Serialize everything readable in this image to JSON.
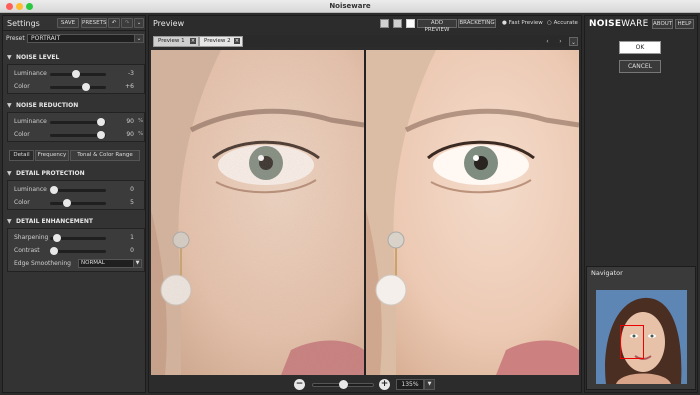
{
  "window": {
    "title": "Noiseware"
  },
  "settings": {
    "title": "Settings",
    "save_label": "SAVE",
    "presets_label": "PRESETS",
    "preset_label": "Preset",
    "preset_value": "PORTRAIT"
  },
  "noise_level": {
    "title": "NOISE LEVEL",
    "rows": [
      {
        "label": "Luminance",
        "value": "-3",
        "level": 0.42
      },
      {
        "label": "Color",
        "value": "+6",
        "level": 0.62
      }
    ]
  },
  "noise_reduction": {
    "title": "NOISE REDUCTION",
    "rows": [
      {
        "label": "Luminance",
        "value": "90",
        "unit": "%",
        "level": 0.9
      },
      {
        "label": "Color",
        "value": "90",
        "unit": "%",
        "level": 0.9
      }
    ]
  },
  "detail_tabs": [
    "Detail",
    "Frequency",
    "Tonal & Color Range"
  ],
  "detail_protection": {
    "title": "DETAIL PROTECTION",
    "rows": [
      {
        "label": "Luminance",
        "value": "0",
        "level": 0.0
      },
      {
        "label": "Color",
        "value": "5",
        "level": 0.25
      }
    ]
  },
  "detail_enhancement": {
    "title": "DETAIL ENHANCEMENT",
    "rows": [
      {
        "label": "Sharpening",
        "value": "1",
        "level": 0.05
      },
      {
        "label": "Contrast",
        "value": "0",
        "level": 0.0
      }
    ],
    "edge_label": "Edge Smoothening",
    "edge_value": "NORMAL"
  },
  "preview": {
    "title": "Preview",
    "add_preview": "ADD PREVIEW",
    "bracketing": "BRACKETING",
    "fast_preview": "Fast Preview",
    "accurate": "Accurate",
    "tabs": [
      "Preview 1",
      "Preview 2"
    ],
    "zoom": "135%",
    "zoom_level": 0.5
  },
  "brand": {
    "bold": "NOISE",
    "rest": "WARE 5"
  },
  "right": {
    "about": "ABOUT",
    "help": "HELP",
    "ok": "OK",
    "cancel": "CANCEL",
    "navigator": "Navigator"
  },
  "colors": {
    "accent_red": "#e00000",
    "panel": "#3b3b3b"
  }
}
